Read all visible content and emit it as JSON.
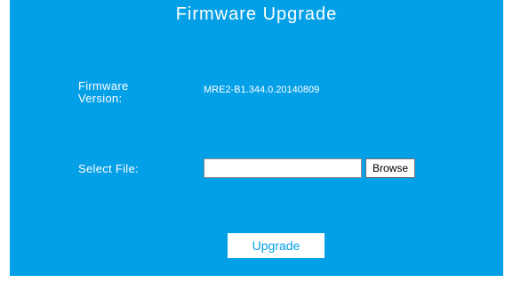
{
  "page": {
    "title": "Firmware Upgrade"
  },
  "firmware": {
    "label_line1": "Firmware",
    "label_line2": "Version:",
    "value": "MRE2-B1.344.0.20140809"
  },
  "file_select": {
    "label": "Select File:",
    "input_value": "",
    "browse_label": "Browse"
  },
  "actions": {
    "upgrade_label": "Upgrade"
  },
  "colors": {
    "panel_background": "#03a0e8",
    "text": "#ffffff",
    "button_background": "#ffffff",
    "upgrade_text": "#03a0e8"
  }
}
